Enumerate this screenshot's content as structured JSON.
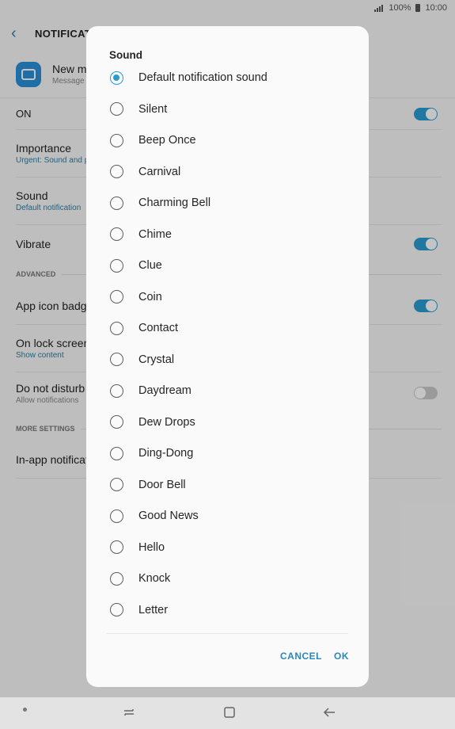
{
  "status": {
    "signal_battery": "100%",
    "time": "10:00"
  },
  "header": {
    "title": "NOTIFICATI"
  },
  "app_row": {
    "name": "New m",
    "subtitle": "Message"
  },
  "settings": {
    "on": "ON",
    "importance": {
      "label": "Importance",
      "value": "Urgent: Sound and p"
    },
    "sound": {
      "label": "Sound",
      "value": "Default notification"
    },
    "vibrate": "Vibrate",
    "advanced": "ADVANCED",
    "app_icon_badges": "App icon badge",
    "lock_screen": {
      "label": "On lock screen",
      "value": "Show content"
    },
    "do_not_disturb": {
      "label": "Do not disturb",
      "value": "Allow notifications"
    },
    "more_settings": "MORE SETTINGS",
    "in_app": "In-app notificat"
  },
  "dialog": {
    "title": "Sound",
    "selected_index": 0,
    "options": [
      "Default notification sound",
      "Silent",
      "Beep Once",
      "Carnival",
      "Charming Bell",
      "Chime",
      "Clue",
      "Coin",
      "Contact",
      "Crystal",
      "Daydream",
      "Dew Drops",
      "Ding-Dong",
      "Door Bell",
      "Good News",
      "Hello",
      "Knock",
      "Letter"
    ],
    "cancel": "CANCEL",
    "ok": "OK"
  },
  "colors": {
    "accent": "#2a9bd0",
    "button_text": "#2a88b8"
  },
  "nav_icons": [
    "dot-icon",
    "recents-icon",
    "home-icon",
    "back-icon"
  ]
}
